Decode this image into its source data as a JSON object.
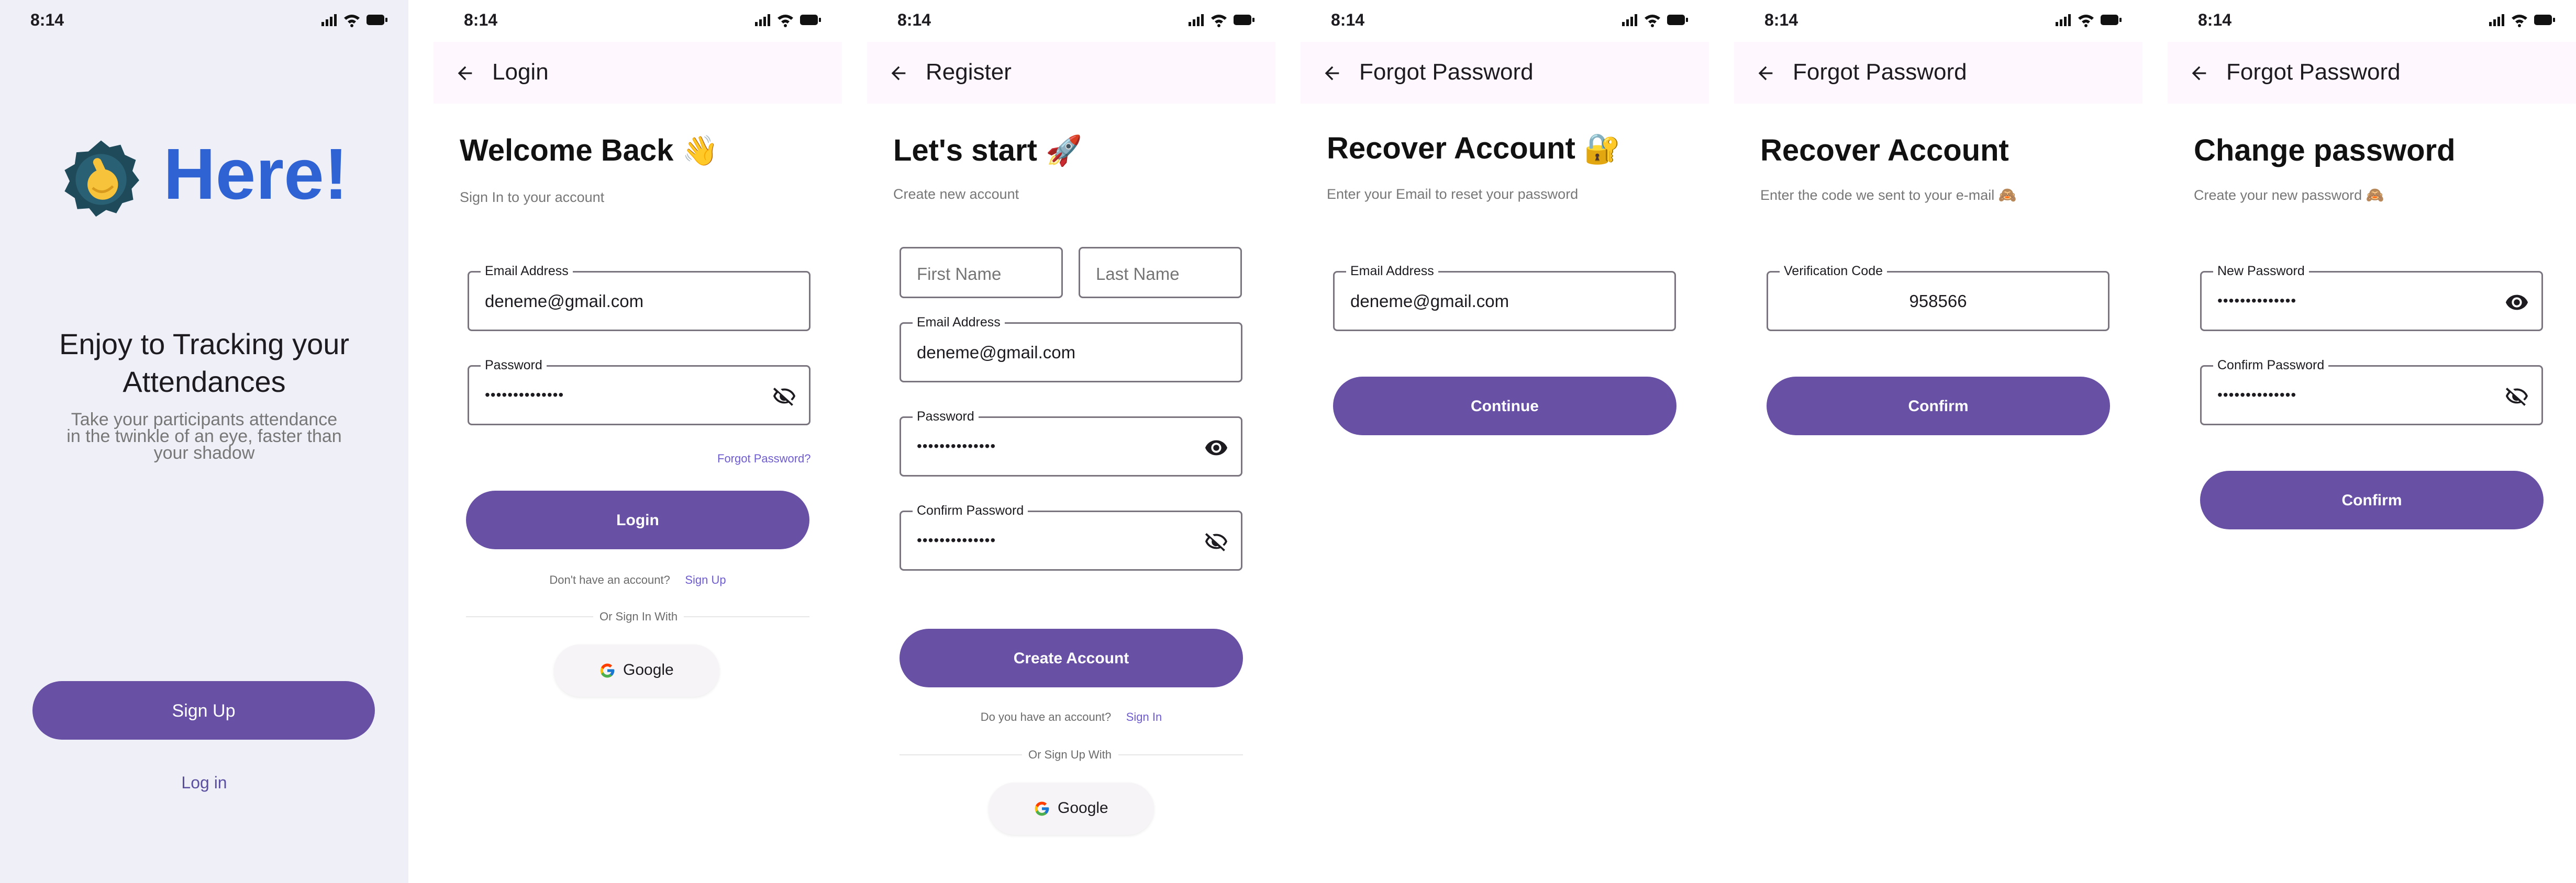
{
  "status_time": "8:14",
  "welcome": {
    "logo_icon": "hand-pointing-badge-icon",
    "brand": "Here!",
    "brand_color": "#2f63d3",
    "headline_line1": "Enjoy to Tracking your",
    "headline_line2": "Attendances",
    "description_line1": "Take your participants attendance",
    "description_line2": "in the twinkle of an eye, faster than",
    "description_line3": "your shadow",
    "signup_label": "Sign Up",
    "login_label": "Log in"
  },
  "login": {
    "appbar_title": "Login",
    "heading": "Welcome Back",
    "heading_emoji": "👋",
    "subtitle": "Sign In to your account",
    "email_label": "Email Address",
    "email_value": "deneme@gmail.com",
    "password_label": "Password",
    "password_masked": "••••••••••••••",
    "forgot_label": "Forgot Password?",
    "login_button": "Login",
    "no_account_text": "Don't have an account?",
    "signup_link": "Sign Up",
    "or_text": "Or Sign In With",
    "google_label": "Google"
  },
  "register": {
    "appbar_title": "Register",
    "heading": "Let's start",
    "heading_emoji": "🚀",
    "subtitle": "Create new account",
    "first_name_placeholder": "First Name",
    "last_name_placeholder": "Last Name",
    "email_label": "Email Address",
    "email_value": "deneme@gmail.com",
    "password_label": "Password",
    "password_masked": "••••••••••••••",
    "confirm_label": "Confirm Password",
    "confirm_masked": "••••••••••••••",
    "create_button": "Create Account",
    "have_account_text": "Do you have an account?",
    "signin_link": "Sign In",
    "or_text": "Or Sign Up With",
    "google_label": "Google"
  },
  "forgot_email": {
    "appbar_title": "Forgot Password",
    "heading": "Recover Account",
    "heading_emoji": "🔐",
    "subtitle": "Enter your Email to reset your password",
    "email_label": "Email Address",
    "email_value": "deneme@gmail.com",
    "continue_button": "Continue"
  },
  "forgot_code": {
    "appbar_title": "Forgot Password",
    "heading": "Recover Account",
    "subtitle": "Enter the code we sent to your e-mail",
    "subtitle_emoji": "🙈",
    "code_label": "Verification Code",
    "code_value": "958566",
    "confirm_button": "Confirm"
  },
  "change_password": {
    "appbar_title": "Forgot Password",
    "heading": "Change password",
    "subtitle": "Create your new password",
    "subtitle_emoji": "🙈",
    "new_label": "New Password",
    "new_masked": "••••••••••••••",
    "confirm_label": "Confirm Password",
    "confirm_masked": "••••••••••••••",
    "confirm_button": "Confirm"
  },
  "colors": {
    "primary": "#6851a5",
    "link": "#6d5bd0",
    "appbar_bg": "#fef7fe",
    "welcome_bg": "#efeff8"
  }
}
